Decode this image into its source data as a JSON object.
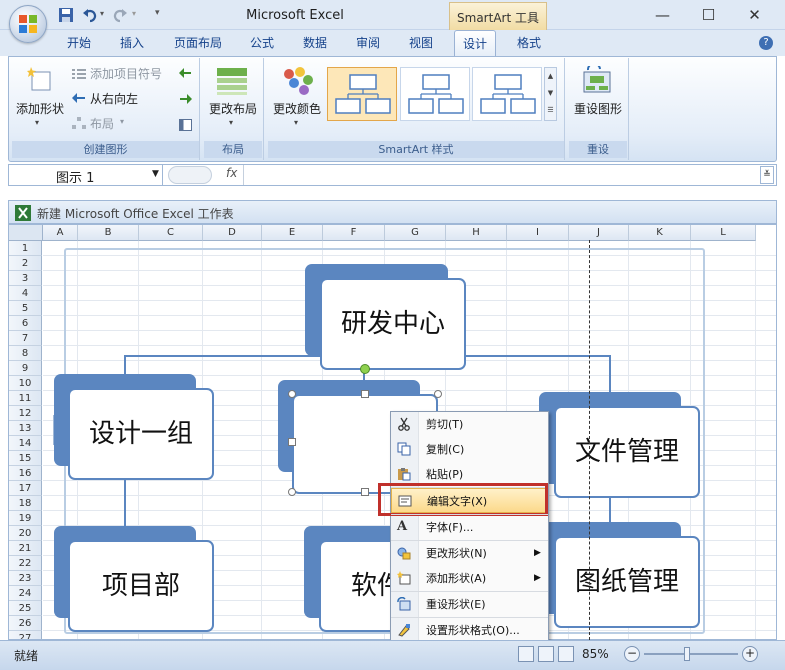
{
  "window": {
    "title": "Microsoft Excel",
    "contextual_tab_group": "SmartArt 工具",
    "minimize_icon": "minimize-icon",
    "maximize_icon": "maximize-icon",
    "close_icon": "close-icon"
  },
  "ribbon_tabs": [
    "开始",
    "插入",
    "页面布局",
    "公式",
    "数据",
    "审阅",
    "视图",
    "设计",
    "格式"
  ],
  "active_tab": "设计",
  "ribbon": {
    "create_graphic": {
      "add_shape": "添加形状",
      "add_bullet": "添加项目符号",
      "right_to_left": "从右向左",
      "layout": "布局",
      "label": "创建图形"
    },
    "layouts": {
      "change_layout": "更改布局",
      "label": "布局"
    },
    "smartart_styles": {
      "change_colors": "更改颜色",
      "label": "SmartArt 样式"
    },
    "reset": {
      "reset_graphic": "重设图形",
      "label": "重设"
    }
  },
  "formula_bar": {
    "name_box": "图示 1",
    "fx": "fx"
  },
  "workbook": {
    "title": "新建 Microsoft Office Excel 工作表"
  },
  "columns": [
    "A",
    "B",
    "C",
    "D",
    "E",
    "F",
    "G",
    "H",
    "I",
    "J",
    "K",
    "L"
  ],
  "rows": [
    "1",
    "2",
    "3",
    "4",
    "5",
    "6",
    "7",
    "8",
    "9",
    "10",
    "11",
    "12",
    "13",
    "14",
    "15",
    "16",
    "17",
    "18",
    "19",
    "20",
    "21",
    "22",
    "23",
    "24",
    "25",
    "26",
    "27"
  ],
  "smartart": {
    "root": "研发中心",
    "level2": [
      "设计一组",
      "",
      "文件管理"
    ],
    "level3": [
      "项目部",
      "软件",
      "图纸管理"
    ]
  },
  "context_menu": {
    "items": [
      {
        "label": "剪切(T)",
        "icon": "scissors-icon",
        "submenu": false
      },
      {
        "label": "复制(C)",
        "icon": "copy-icon",
        "submenu": false
      },
      {
        "label": "粘贴(P)",
        "icon": "paste-icon",
        "submenu": false
      },
      {
        "label": "编辑文字(X)",
        "icon": "edit-text-icon",
        "submenu": false,
        "highlighted": true
      },
      {
        "label": "字体(F)...",
        "icon": "font-icon",
        "submenu": false
      },
      {
        "label": "更改形状(N)",
        "icon": "change-shape-icon",
        "submenu": true
      },
      {
        "label": "添加形状(A)",
        "icon": "add-shape-icon",
        "submenu": true
      },
      {
        "label": "重设形状(E)",
        "icon": "reset-shape-icon",
        "submenu": false
      },
      {
        "label": "设置形状格式(O)...",
        "icon": "format-shape-icon",
        "submenu": false
      }
    ]
  },
  "status_bar": {
    "status": "就绪",
    "zoom": "85%"
  },
  "colors": {
    "accent": "#5b86c0",
    "highlight_box": "#c0302b",
    "menu_highlight": "#fcd98b"
  }
}
